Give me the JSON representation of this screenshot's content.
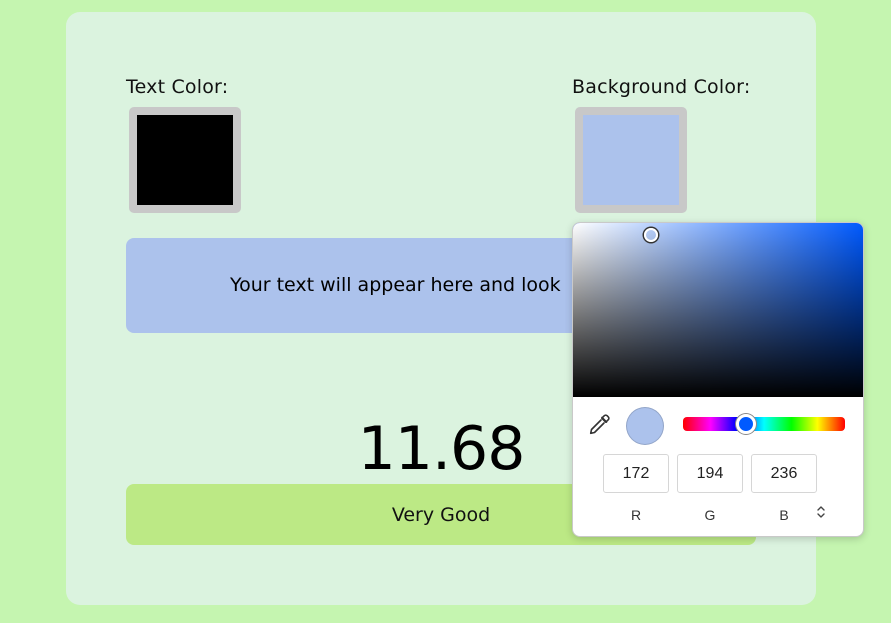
{
  "text_color": {
    "label": "Text Color:",
    "value": "#000000"
  },
  "background_color": {
    "label": "Background Color:",
    "value": "#acc2ec"
  },
  "preview": {
    "text": "Your text will appear here and look"
  },
  "contrast": {
    "ratio": "11.68",
    "rating": "Very Good",
    "rating_color": "#bce985"
  },
  "picker": {
    "hue_color": "#005aff",
    "hue_fraction": 0.39,
    "r": "172",
    "g": "194",
    "b": "236",
    "r_label": "R",
    "g_label": "G",
    "b_label": "B",
    "eyedropper_icon": "eyedropper-icon",
    "toggle_icon": "up-down-chevron-icon"
  }
}
